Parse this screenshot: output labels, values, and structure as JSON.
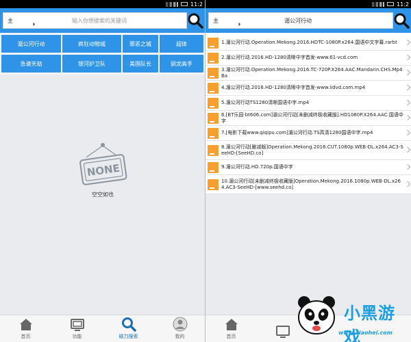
{
  "status": {
    "left_time": "11:2",
    "right_time": "11:2"
  },
  "left": {
    "search": {
      "scope": "主",
      "placeholder": "输入你想搜索的关键词"
    },
    "hot_tags": [
      "湄公河行动",
      "疯狂动物城",
      "罪恶之城",
      "超体",
      "急速天劫",
      "银河护卫队",
      "美国队长",
      "驯龙高手"
    ],
    "empty": {
      "badge": "NONE",
      "text": "空空如也"
    }
  },
  "right": {
    "search": {
      "scope": "主",
      "value": "湄公河行动"
    },
    "results": [
      "1.湄公河行动.Operation.Mekong.2016.HDTC-1080P.x264.国语中文字幕.rarbt",
      "2.湄公河行动.2016.HD-1280清晰中字首发-www.61-vcd.com",
      "3.湄公河行动.Operation.Mekong.2016.TC-720P.X264.AAC.Mandarin.CHS.Mp4Ba",
      "4.湄公河行动.2016.HD-1280清晰中字首发-www.iidvd.com.mp4",
      "5.湄公河行动TS1280清晰国语中字.mp4",
      "6.[BT乐园·bt606.com]湄公河行动[未删减终极收藏版].HD1080P.X264.AAC.国语中字",
      "7.[电影下载www.qiqipu.com]湄公河行动.TS高清1280国语中字.mp4",
      "8.湄公河行动[删减版]Operation.Mekong.2016.CUT.1080p.WEB-DL.x264.AC3-SeeHD-[SeeHD.co]",
      "9.湄公河行动.HD.720p.国语中字",
      "10.湄公河行动[未删减终极收藏版]Operation.Mekong.2016.1080p.WEB-DL.x264.AC3-SeeHD-[www.seehd.co]"
    ]
  },
  "tabs": [
    "首页",
    "功能",
    "磁力搜索",
    "我的"
  ],
  "watermark": {
    "brand": "小黑游戏",
    "url": "www.xiaohei.com"
  },
  "colors": {
    "accent": "#2f93e8",
    "file_icon": "#f7a030"
  }
}
